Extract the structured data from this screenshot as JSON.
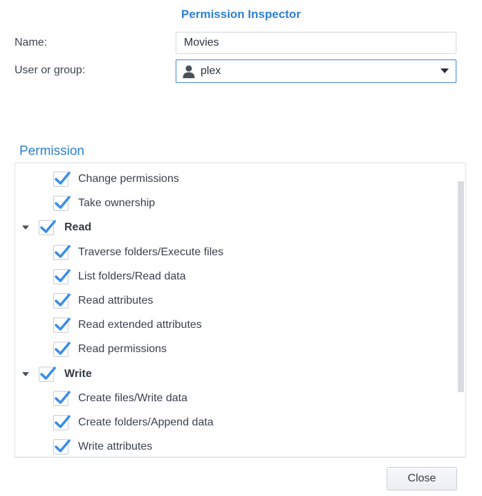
{
  "dialog": {
    "title": "Permission Inspector"
  },
  "form": {
    "name_label": "Name:",
    "name_value": "Movies",
    "user_label": "User or group:",
    "user_value": "plex"
  },
  "permission": {
    "section_title": "Permission",
    "rows": [
      {
        "label": "Change permissions",
        "checked": true
      },
      {
        "label": "Take ownership",
        "checked": true
      },
      {
        "label": "Read",
        "checked": true,
        "group": true,
        "expanded": true
      },
      {
        "label": "Traverse folders/Execute files",
        "checked": true
      },
      {
        "label": "List folders/Read data",
        "checked": true
      },
      {
        "label": "Read attributes",
        "checked": true
      },
      {
        "label": "Read extended attributes",
        "checked": true
      },
      {
        "label": "Read permissions",
        "checked": true
      },
      {
        "label": "Write",
        "checked": true,
        "group": true,
        "expanded": true
      },
      {
        "label": "Create files/Write data",
        "checked": true
      },
      {
        "label": "Create folders/Append data",
        "checked": true
      },
      {
        "label": "Write attributes",
        "checked": true
      }
    ]
  },
  "footer": {
    "close_label": "Close"
  },
  "icons": {
    "user": "user-icon",
    "caret": "chevron-down-icon",
    "check": "checkmark-icon",
    "expand": "expand-triangle-icon"
  },
  "colors": {
    "accent": "#2f7fd1",
    "check": "#3a8ee6"
  }
}
